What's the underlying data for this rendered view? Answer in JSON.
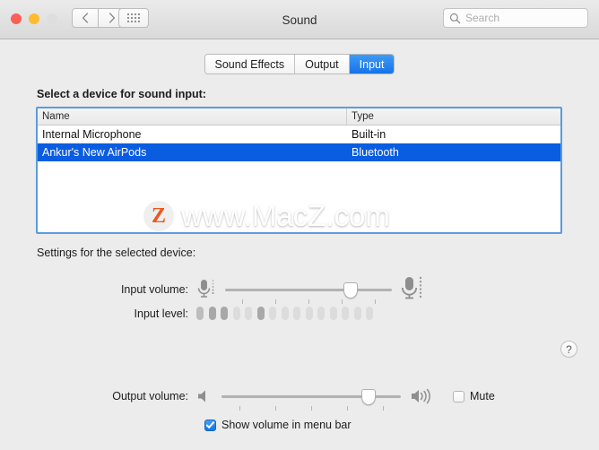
{
  "window": {
    "title": "Sound",
    "traffic_lights": [
      "close",
      "minimize",
      "zoom"
    ],
    "nav_back": "‹",
    "nav_forward": "›",
    "grid_icon": "grid-all-preferences-icon"
  },
  "search": {
    "placeholder": "Search",
    "icon": "search-icon"
  },
  "tabs": [
    {
      "label": "Sound Effects",
      "active": false
    },
    {
      "label": "Output",
      "active": false
    },
    {
      "label": "Input",
      "active": true
    }
  ],
  "device_section": {
    "heading": "Select a device for sound input:",
    "columns": [
      "Name",
      "Type"
    ],
    "rows": [
      {
        "name": "Internal Microphone",
        "type": "Built-in",
        "selected": false
      },
      {
        "name": "Ankur's New AirPods",
        "type": "Bluetooth",
        "selected": true
      }
    ]
  },
  "watermark": {
    "logo_letter": "Z",
    "text": "www.MacZ.com"
  },
  "settings_section": {
    "heading": "Settings for the selected device:",
    "input_volume": {
      "label": "Input volume:",
      "value_percent": 75,
      "left_icon": "microphone-small-icon",
      "right_icon": "microphone-large-icon",
      "tick_count": 5
    },
    "input_level": {
      "label": "Input level:",
      "segment_count": 15,
      "segments_state": [
        "on",
        "on",
        "on",
        "off",
        "off",
        "on",
        "off",
        "off",
        "off",
        "off",
        "off",
        "off",
        "off",
        "off",
        "off"
      ]
    }
  },
  "help_button": {
    "label": "?",
    "icon": "help-question-icon"
  },
  "output": {
    "label": "Output volume:",
    "value_percent": 82,
    "tick_count": 5,
    "mute_label": "Mute",
    "mute_checked": false,
    "low_icon": "speaker-muted-icon",
    "high_icon": "speaker-loud-icon",
    "show_in_menubar_label": "Show volume in menu bar",
    "show_in_menubar_checked": true
  },
  "colors": {
    "accent_blue": "#0a5ce0",
    "tab_blue": "#1573e8",
    "focus_ring": "#5b9bdf",
    "window_bg": "#ececec",
    "watermark_orange": "#e8591f"
  }
}
